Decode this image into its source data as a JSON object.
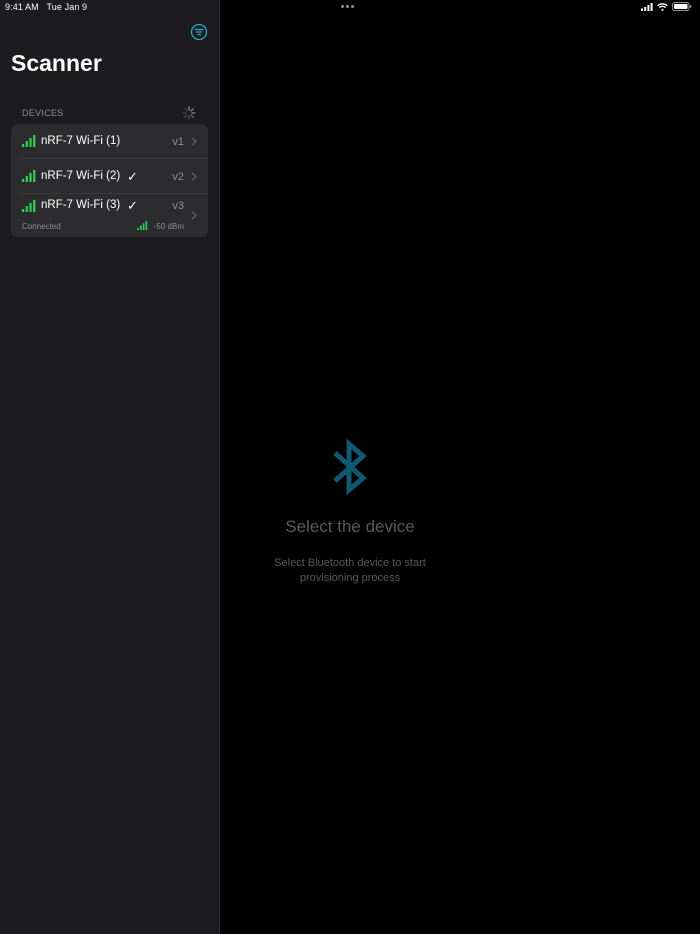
{
  "status_bar": {
    "time": "9:41 AM",
    "date": "Tue Jan 9"
  },
  "sidebar": {
    "title": "Scanner",
    "section_header": "DEVICES",
    "devices": [
      {
        "name": "nRF-7 Wi-Fi (1)",
        "version": "v1",
        "checked": false
      },
      {
        "name": "nRF-7 Wi-Fi (2)",
        "version": "v2",
        "checked": true
      },
      {
        "name": "nRF-7 Wi-Fi (3)",
        "version": "v3",
        "checked": true,
        "status": "Connected",
        "rssi": "-50 dBm"
      }
    ],
    "check_mark": "✓"
  },
  "detail": {
    "title": "Select the device",
    "subtitle": "Select Bluetooth device to start provisioning process"
  },
  "icons": {
    "filter": "filter-icon",
    "bluetooth": "bluetooth-icon",
    "spinner": "activity-spinner-icon",
    "chevron": "chevron-right-icon",
    "signal": "signal-bars-icon"
  },
  "colors": {
    "accent": "#0a84ff",
    "signal_green": "#30d158",
    "bluetooth_teal": "#0f5a73",
    "secondary_text": "#8e8e93"
  }
}
